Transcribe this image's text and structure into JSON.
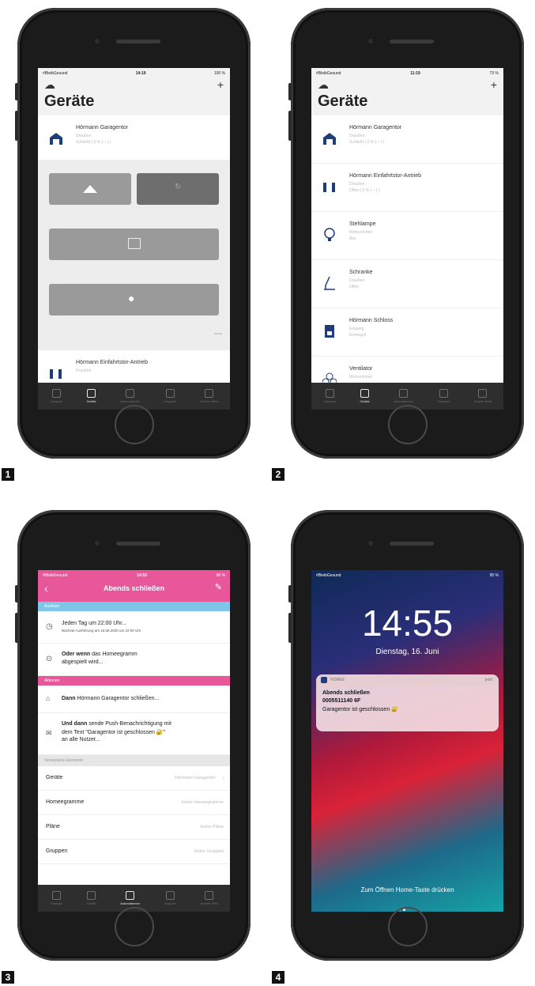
{
  "panels": [
    {
      "badge": "1"
    },
    {
      "badge": "2"
    },
    {
      "badge": "3"
    },
    {
      "badge": "4"
    }
  ],
  "p1": {
    "status_left": "#BleibGesund",
    "time": "14:19",
    "status_right": "100 %",
    "title": "Geräte",
    "add": "+",
    "dev1_name": "Hörmann Garagentor",
    "dev1_room": "Draußen",
    "dev1_state": "Schließt ( 0 % ) – ( )",
    "dev2_name": "Hörmann Einfahrtstor-Antrieb",
    "dev2_room": "Draußen"
  },
  "p2": {
    "status_left": "#BleibGesund",
    "time": "11:19",
    "status_right": "73 %",
    "title": "Geräte",
    "add": "+",
    "devices": [
      {
        "name": "Hörmann Garagentor",
        "room": "Draußen",
        "state": "Schließt ( 0 % ) – ( )"
      },
      {
        "name": "Hörmann Einfahrtstor-Antrieb",
        "room": "Draußen",
        "state": "Offen ( 0 % ) – ( )"
      },
      {
        "name": "Stehlampe",
        "room": "Wohnzimmer",
        "state": "Aus"
      },
      {
        "name": "Schranke",
        "room": "Draußen",
        "state": "Offen"
      },
      {
        "name": "Hörmann Schloss",
        "room": "Eingang",
        "state": "Entriegelt"
      },
      {
        "name": "Ventilator",
        "room": "Wohnzimmer",
        "state": ""
      }
    ]
  },
  "p3": {
    "status_left": "#BleibGesund",
    "time": "14:53",
    "status_right": "96 %",
    "title": "Abends schließen",
    "section_when": "Auslöser",
    "trigger1_main": "Jeden Tag um 22:00 Uhr...",
    "trigger1_sub": "Nächste Ausführung am 16.06.2020 um 22:00 Uhr",
    "trigger2_bold": "Oder wenn",
    "trigger2_rest": " das Homeegramm",
    "trigger2_line2": "abgespielt wird...",
    "section_actions": "Aktionen",
    "action1_bold": "Dann",
    "action1_rest": " Hörmann Garagentor schließen...",
    "action2_bold": "Und dann",
    "action2_rest": " sende Push-Benachrichtigung mit",
    "action2_line2": "dem Text \"Garagentor ist geschlossen 🔐\"",
    "action2_line3": "an alle Nutzer...",
    "section_used": "Verwendete Elemente",
    "list": [
      {
        "label": "Geräte",
        "value": "Hörmann Garagentor"
      },
      {
        "label": "Homeegramme",
        "value": "Keine Homeegramme"
      },
      {
        "label": "Pläne",
        "value": "Keine Pläne"
      },
      {
        "label": "Gruppen",
        "value": "Keine Gruppen"
      }
    ]
  },
  "p4": {
    "status_left": "#BleibGesund",
    "status_right": "95 %",
    "clock": "14:55",
    "date": "Dienstag, 16. Juni",
    "notif_app": "HOMEE",
    "notif_time": "jetzt",
    "notif_title": "Abends schließen",
    "notif_id": "0005511140 6F",
    "notif_text": "Garagentor ist geschlossen 🔐",
    "bottom_hint": "Zum Öffnen Home-Taste drücken"
  },
  "tabs": [
    "Zuhause",
    "Geräte",
    "Automationen",
    "Gruppen",
    "Homee Welt"
  ],
  "colors": {
    "pink": "#e8579a",
    "blue": "#7fc6e8",
    "device_blue": "#1e3d7a",
    "tabbar": "#2e2e2e"
  }
}
